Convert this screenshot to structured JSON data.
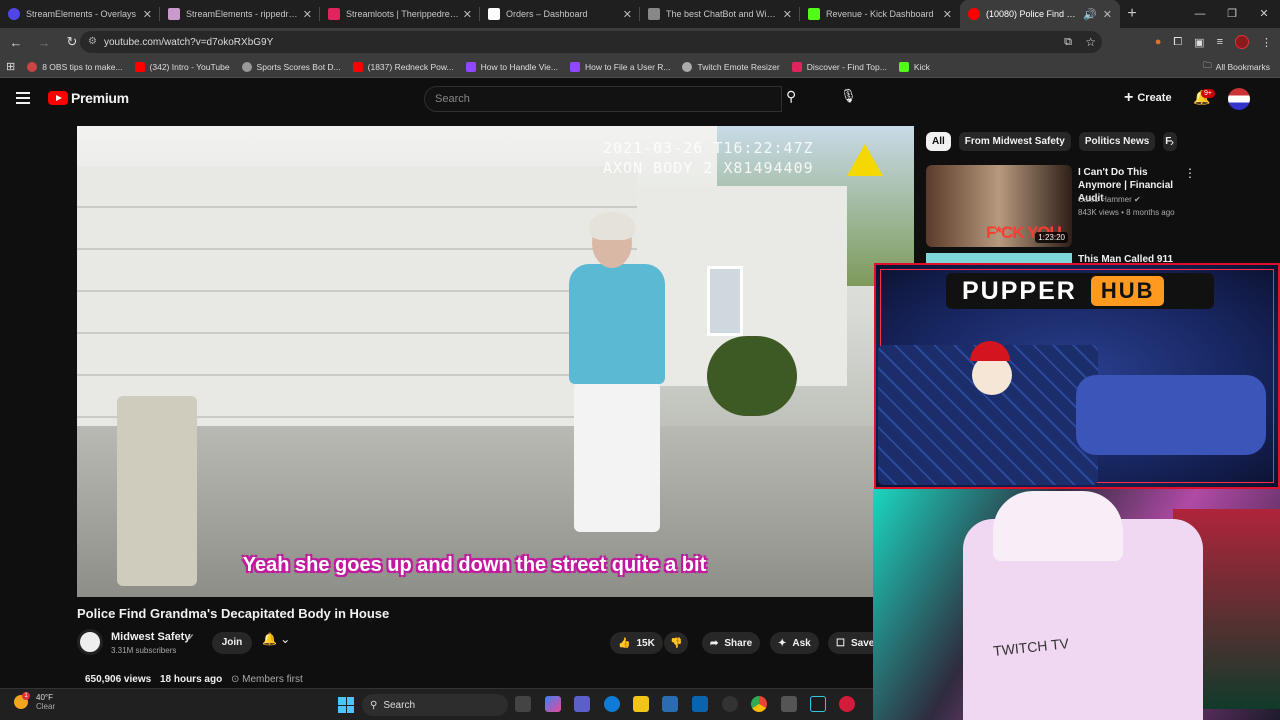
{
  "browser": {
    "tabs": [
      {
        "title": "StreamElements - Overlays",
        "color": "#4f46e5"
      },
      {
        "title": "StreamElements - rippedredne",
        "color": "#4f46e5"
      },
      {
        "title": "Streamloots | Therippedredneck",
        "color": "#e0245e"
      },
      {
        "title": "Orders – Dashboard",
        "color": "#ffffff"
      },
      {
        "title": "The best ChatBot and Widgets",
        "color": "#888888"
      },
      {
        "title": "Revenue - Kick Dashboard",
        "color": "#53fc18"
      },
      {
        "title": "(10080) Police Find Grandm",
        "color": "#ff0000"
      }
    ],
    "url": "youtube.com/watch?v=d7okoRXbG9Y",
    "bookmarks": [
      {
        "label": "8 OBS tips to make...",
        "color": "#c44"
      },
      {
        "label": "(342) Intro - YouTube",
        "color": "#ff0000"
      },
      {
        "label": "Sports Scores Bot D...",
        "color": "#999"
      },
      {
        "label": "(1837) Redneck Pow...",
        "color": "#ff0000"
      },
      {
        "label": "How to Handle Vie...",
        "color": "#9146ff"
      },
      {
        "label": "How to File a User R...",
        "color": "#9146ff"
      },
      {
        "label": "Twitch Emote Resizer",
        "color": "#aaa"
      },
      {
        "label": "Discover - Find Top...",
        "color": "#e0245e"
      },
      {
        "label": "Kick",
        "color": "#53fc18"
      }
    ],
    "all_bookmarks": "All Bookmarks"
  },
  "youtube": {
    "logo": "Premium",
    "search_placeholder": "Search",
    "create": "Create",
    "notif_count": "9+",
    "video": {
      "timestamp_line1": "2021-03-26 T16:22:47Z",
      "timestamp_line2": "AXON BODY 2 X81494409",
      "caption": "Yeah she goes up and down the street quite a bit",
      "title": "Police Find Grandma's Decapitated Body in House",
      "channel": "Midwest Safety",
      "subscribers": "3.31M subscribers",
      "join": "Join",
      "likes": "15K",
      "share": "Share",
      "ask": "Ask",
      "save": "Save",
      "views": "650,906 views",
      "age": "18 hours ago",
      "members": "Members first"
    },
    "chips": [
      "All",
      "From Midwest Safety",
      "Politics News",
      "F"
    ],
    "recommended": [
      {
        "title": "I Can't Do This Anymore | Financial Audit",
        "channel": "Caleb Hammer",
        "meta": "843K views • 8 months ago",
        "duration": "1:23:20",
        "thumb_text": "F*CK YOU"
      },
      {
        "title": "This Man Called 911"
      }
    ]
  },
  "overlay": {
    "brand_left": "PUPPER",
    "brand_right": "HUB",
    "cam_text": "TWITCH TV"
  },
  "taskbar": {
    "temp": "40°F",
    "condition": "Clear",
    "search": "Search",
    "weather_badge": "1"
  }
}
